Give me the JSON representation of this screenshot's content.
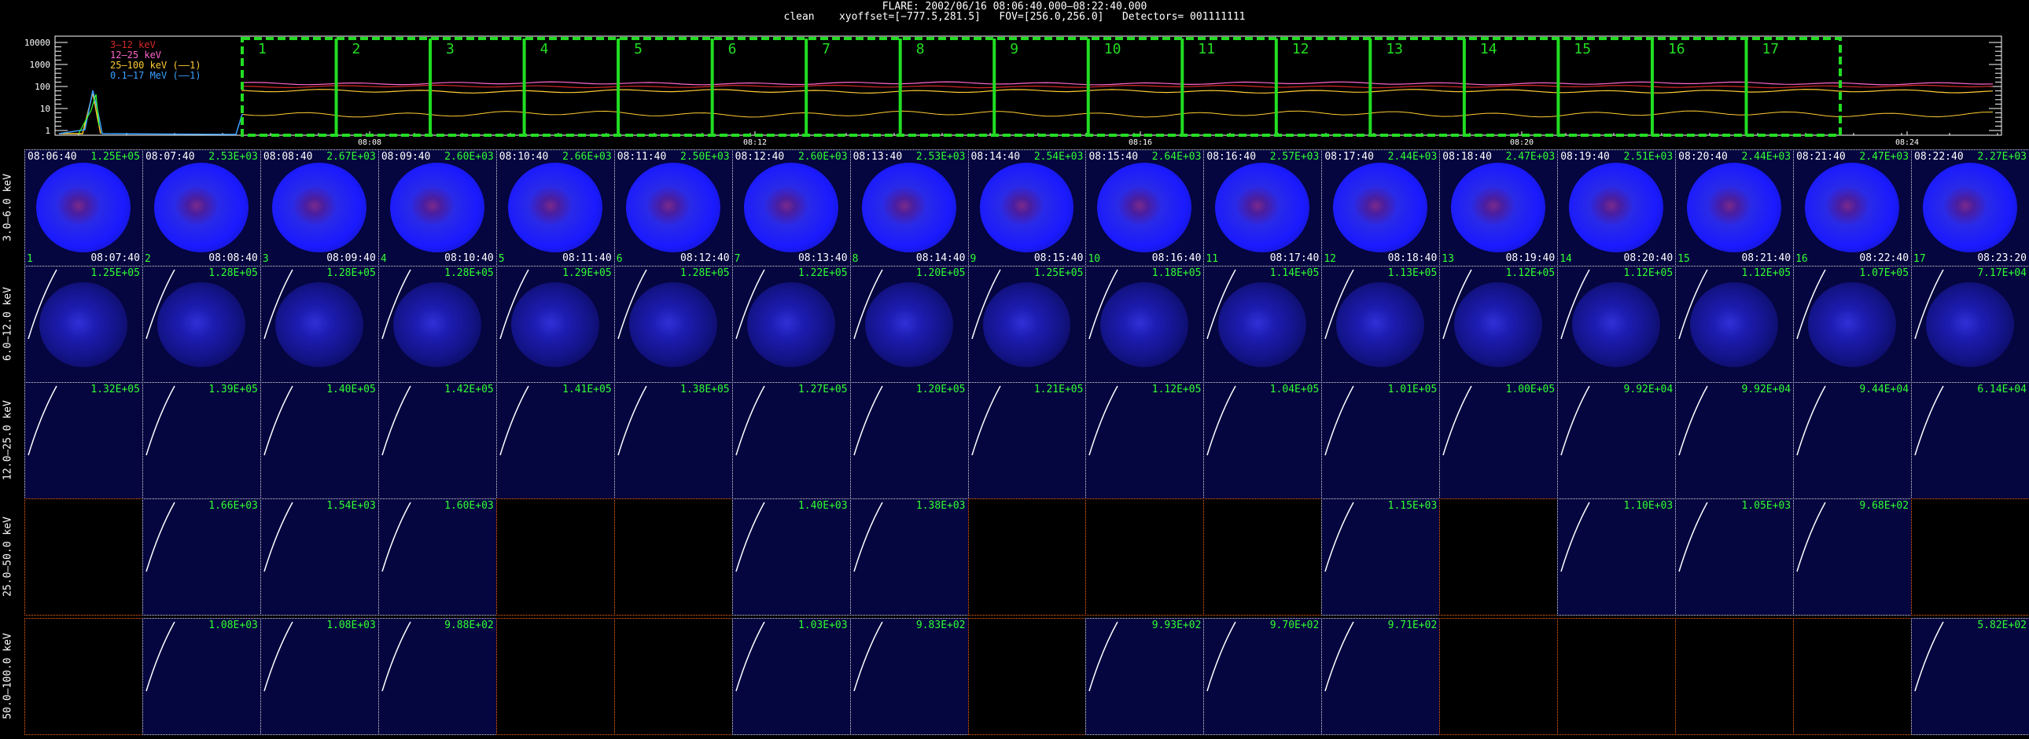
{
  "header": {
    "title": "FLARE: 2002/06/16 08:06:40.000–08:22:40.000",
    "params": "clean    xyoffset=[−777.5,281.5]   FOV=[256.0,256.0]   Detectors= 001111111"
  },
  "lightcurve": {
    "legend": [
      {
        "label": "3–12 keV",
        "color": "#d62828"
      },
      {
        "label": "12–25 keV",
        "color": "#ff66cc"
      },
      {
        "label": "25–100 keV (——1)",
        "color": "#ffcc33"
      },
      {
        "label": "0.1–17 MeV (——1)",
        "color": "#3aa0ff"
      }
    ],
    "y_ticks": [
      "10000",
      "1000",
      "100",
      "10",
      "1"
    ],
    "x_ticks": [
      "08:08",
      "08:12",
      "08:16",
      "08:20",
      "08:24"
    ],
    "intervals": [
      "1",
      "2",
      "3",
      "4",
      "5",
      "6",
      "7",
      "8",
      "9",
      "10",
      "11",
      "12",
      "13",
      "14",
      "15",
      "16",
      "17"
    ]
  },
  "rows": [
    {
      "energy": "3.0–6.0 keV",
      "filled": [
        1,
        1,
        1,
        1,
        1,
        1,
        1,
        1,
        1,
        1,
        1,
        1,
        1,
        1,
        1,
        1,
        1
      ],
      "peaks": [
        "1.25E+05",
        "2.53E+03",
        "2.67E+03",
        "2.60E+03",
        "2.66E+03",
        "2.50E+03",
        "2.60E+03",
        "2.53E+03",
        "2.54E+03",
        "2.64E+03",
        "2.57E+03",
        "2.44E+03",
        "2.47E+03",
        "2.51E+03",
        "2.44E+03",
        "2.47E+03",
        "2.27E+03"
      ]
    },
    {
      "energy": "6.0–12.0 keV",
      "filled": [
        1,
        1,
        1,
        1,
        1,
        1,
        1,
        1,
        1,
        1,
        1,
        1,
        1,
        1,
        1,
        1,
        1
      ],
      "peaks": [
        "1.25E+05",
        "1.28E+05",
        "1.28E+05",
        "1.28E+05",
        "1.29E+05",
        "1.28E+05",
        "1.22E+05",
        "1.20E+05",
        "1.25E+05",
        "1.18E+05",
        "1.14E+05",
        "1.13E+05",
        "1.12E+05",
        "1.12E+05",
        "1.12E+05",
        "1.07E+05",
        "7.17E+04"
      ]
    },
    {
      "energy": "12.0–25.0 keV",
      "filled": [
        1,
        1,
        1,
        1,
        1,
        1,
        1,
        1,
        1,
        1,
        1,
        1,
        1,
        1,
        1,
        1,
        1
      ],
      "peaks": [
        "1.32E+05",
        "1.39E+05",
        "1.40E+05",
        "1.42E+05",
        "1.41E+05",
        "1.38E+05",
        "1.27E+05",
        "1.20E+05",
        "1.21E+05",
        "1.12E+05",
        "1.04E+05",
        "1.01E+05",
        "1.00E+05",
        "9.92E+04",
        "9.92E+04",
        "9.44E+04",
        "6.14E+04"
      ]
    },
    {
      "energy": "25.0–50.0 keV",
      "filled": [
        0,
        1,
        1,
        1,
        0,
        0,
        1,
        1,
        0,
        0,
        0,
        1,
        0,
        1,
        1,
        1,
        0
      ],
      "peaks": [
        "",
        "1.66E+03",
        "1.54E+03",
        "1.60E+03",
        "",
        "",
        "1.40E+03",
        "1.38E+03",
        "",
        "",
        "",
        "1.15E+03",
        "",
        "1.10E+03",
        "1.05E+03",
        "9.68E+02",
        ""
      ]
    },
    {
      "energy": "50.0–100.0 keV",
      "filled": [
        0,
        1,
        1,
        1,
        0,
        0,
        1,
        1,
        0,
        1,
        1,
        1,
        0,
        0,
        0,
        0,
        1
      ],
      "peaks": [
        "",
        "1.08E+03",
        "1.08E+03",
        "9.88E+02",
        "",
        "",
        "1.03E+03",
        "9.83E+02",
        "",
        "9.93E+02",
        "9.70E+02",
        "9.71E+02",
        "",
        "",
        "",
        "",
        "5.82E+02"
      ]
    }
  ],
  "start_times": [
    "08:06:40",
    "08:07:40",
    "08:08:40",
    "08:09:40",
    "08:10:40",
    "08:11:40",
    "08:12:40",
    "08:13:40",
    "08:14:40",
    "08:15:40",
    "08:16:40",
    "08:17:40",
    "08:18:40",
    "08:19:40",
    "08:20:40",
    "08:21:40",
    "08:22:40"
  ],
  "end_times": [
    "08:07:40",
    "08:08:40",
    "08:09:40",
    "08:10:40",
    "08:11:40",
    "08:12:40",
    "08:13:40",
    "08:14:40",
    "08:15:40",
    "08:16:40",
    "08:17:40",
    "08:18:40",
    "08:19:40",
    "08:20:40",
    "08:21:40",
    "08:22:40",
    "08:23:20"
  ],
  "colors": {
    "background": "#000000",
    "interval_box": "#22dd22",
    "label_green": "#32ff32",
    "image_blue": "#1a1aff",
    "core": "#7a2a8a",
    "empty_border": "#ff6a1a"
  }
}
